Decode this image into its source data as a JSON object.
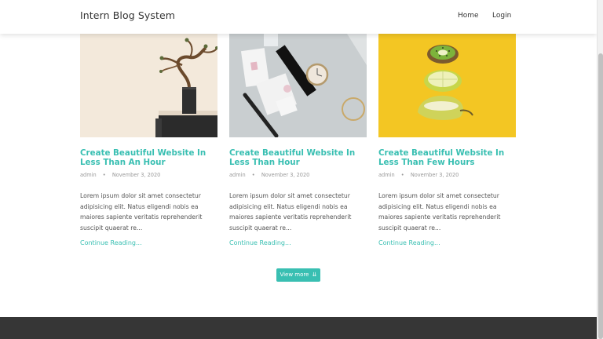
{
  "navbar": {
    "brand": "Intern Blog System",
    "links": [
      "Home",
      "Login"
    ]
  },
  "posts": [
    {
      "title": "Create Beautiful Website In Less Than An Hour",
      "author": "admin",
      "date": "November 3, 2020",
      "excerpt": "Lorem ipsum dolor sit amet consectetur adipisicing elit. Natus eligendi nobis ea maiores sapiente veritatis reprehenderit suscipit quaerat re...",
      "read_more": "Continue Reading..."
    },
    {
      "title": "Create Beautiful Website In Less Than Hour",
      "author": "admin",
      "date": "November 3, 2020",
      "excerpt": "Lorem ipsum dolor sit amet consectetur adipisicing elit. Natus eligendi nobis ea maiores sapiente veritatis reprehenderit suscipit quaerat re...",
      "read_more": "Continue Reading..."
    },
    {
      "title": "Create Beautiful Website In Less Than Few Hours",
      "author": "admin",
      "date": "November 3, 2020",
      "excerpt": "Lorem ipsum dolor sit amet consectetur adipisicing elit. Natus eligendi nobis ea maiores sapiente veritatis reprehenderit suscipit quaerat re...",
      "read_more": "Continue Reading..."
    }
  ],
  "view_more": {
    "label": "View more",
    "icon": "double-arrow-down-icon",
    "glyph": "⇊"
  },
  "colors": {
    "accent": "#39bfb2",
    "footer": "#363636",
    "post3_background": "#f3c623"
  }
}
